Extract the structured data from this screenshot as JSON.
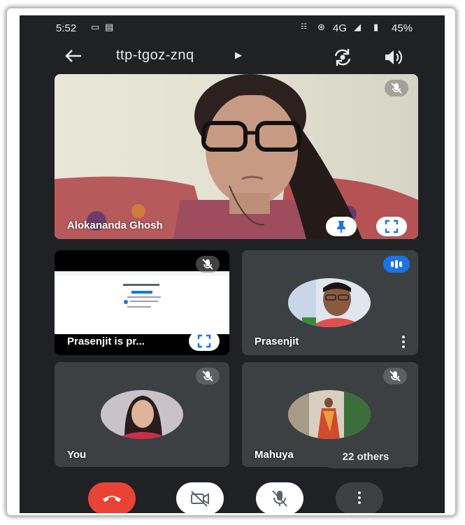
{
  "status_bar": {
    "time": "5:52",
    "network": "4G",
    "battery": "45%"
  },
  "top_bar": {
    "meeting_code": "ttp-tgoz-znq"
  },
  "main_tile": {
    "participant_name": "Alokananda Ghosh"
  },
  "tiles": {
    "presentation": {
      "label": "Prasenjit is pr..."
    },
    "prasenjit": {
      "name": "Prasenjit"
    },
    "you": {
      "name": "You"
    },
    "mahuya": {
      "name": "Mahuya",
      "others_label": "22 others"
    }
  },
  "colors": {
    "background": "#202124",
    "tile": "#3c4043",
    "end_call": "#ea4335",
    "speaking": "#1a73e8"
  },
  "controls": [
    "end-call",
    "camera-off",
    "mic-off",
    "more-options"
  ]
}
